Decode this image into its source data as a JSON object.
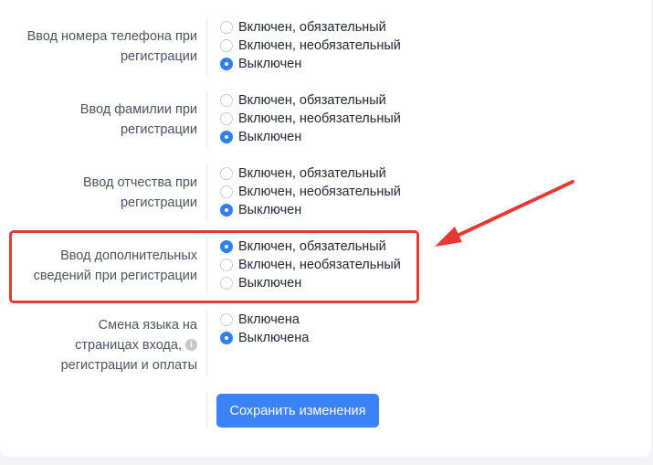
{
  "settings": [
    {
      "label_lines": [
        "Ввод номера телефона при",
        "регистрации"
      ],
      "options": [
        "Включен, обязательный",
        "Включен, необязательный",
        "Выключен"
      ],
      "selected": 2
    },
    {
      "label_lines": [
        "Ввод фамилии при",
        "регистрации"
      ],
      "options": [
        "Включен, обязательный",
        "Включен, необязательный",
        "Выключен"
      ],
      "selected": 2
    },
    {
      "label_lines": [
        "Ввод отчества при",
        "регистрации"
      ],
      "options": [
        "Включен, обязательный",
        "Включен, необязательный",
        "Выключен"
      ],
      "selected": 2
    },
    {
      "label_lines": [
        "Ввод дополнительных",
        "сведений при регистрации"
      ],
      "options": [
        "Включен, обязательный",
        "Включен, необязательный",
        "Выключен"
      ],
      "selected": 0,
      "highlighted": true
    },
    {
      "label_lines": [
        "Смена языка на",
        "страницах входа,",
        "регистрации и оплаты"
      ],
      "has_info_icon": true,
      "options": [
        "Включена",
        "Выключена"
      ],
      "selected": 1
    }
  ],
  "save_button_label": "Сохранить изменения",
  "colors": {
    "accent": "#3b82f6",
    "radio_selected": "#2f80ed",
    "highlight": "#e53935",
    "label_text": "#4a5361"
  }
}
